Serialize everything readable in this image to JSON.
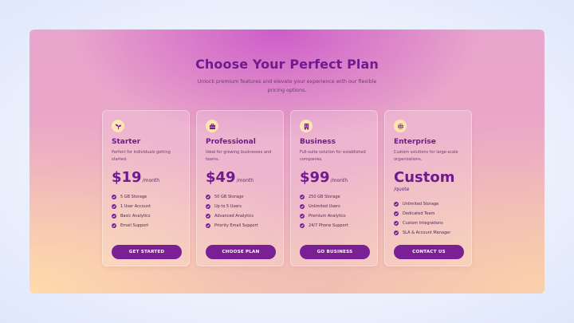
{
  "header": {
    "title": "Choose Your Perfect Plan",
    "subtitle": "Unlock premium features and elevate your experience with our flexible pricing options."
  },
  "plans": [
    {
      "icon": "sprout-icon",
      "name": "Starter",
      "description": "Perfect for individuals getting started.",
      "price": "$19",
      "period": "/month",
      "features": [
        "5 GB Storage",
        "1 User Account",
        "Basic Analytics",
        "Email Support"
      ],
      "button": "GET STARTED"
    },
    {
      "icon": "briefcase-icon",
      "name": "Professional",
      "description": "Ideal for growing businesses and teams.",
      "price": "$49",
      "period": "/month",
      "features": [
        "50 GB Storage",
        "Up to 5 Users",
        "Advanced Analytics",
        "Priority Email Support"
      ],
      "button": "CHOOSE PLAN"
    },
    {
      "icon": "building-icon",
      "name": "Business",
      "description": "Full-suite solution for established companies.",
      "price": "$99",
      "period": "/month",
      "features": [
        "250 GB Storage",
        "Unlimited Users",
        "Premium Analytics",
        "24/7 Phone Support"
      ],
      "button": "GO BUSINESS"
    },
    {
      "icon": "globe-icon",
      "name": "Enterprise",
      "description": "Custom solutions for large-scale organizations.",
      "price": "Custom",
      "period": "/quote",
      "features": [
        "Unlimited Storage",
        "Dedicated Team",
        "Custom Integrations",
        "SLA & Account Manager"
      ],
      "button": "CONTACT US"
    }
  ],
  "colors": {
    "accent": "#7a1f94",
    "title": "#6f1a8f",
    "icon_bg": "#fde6b2"
  }
}
